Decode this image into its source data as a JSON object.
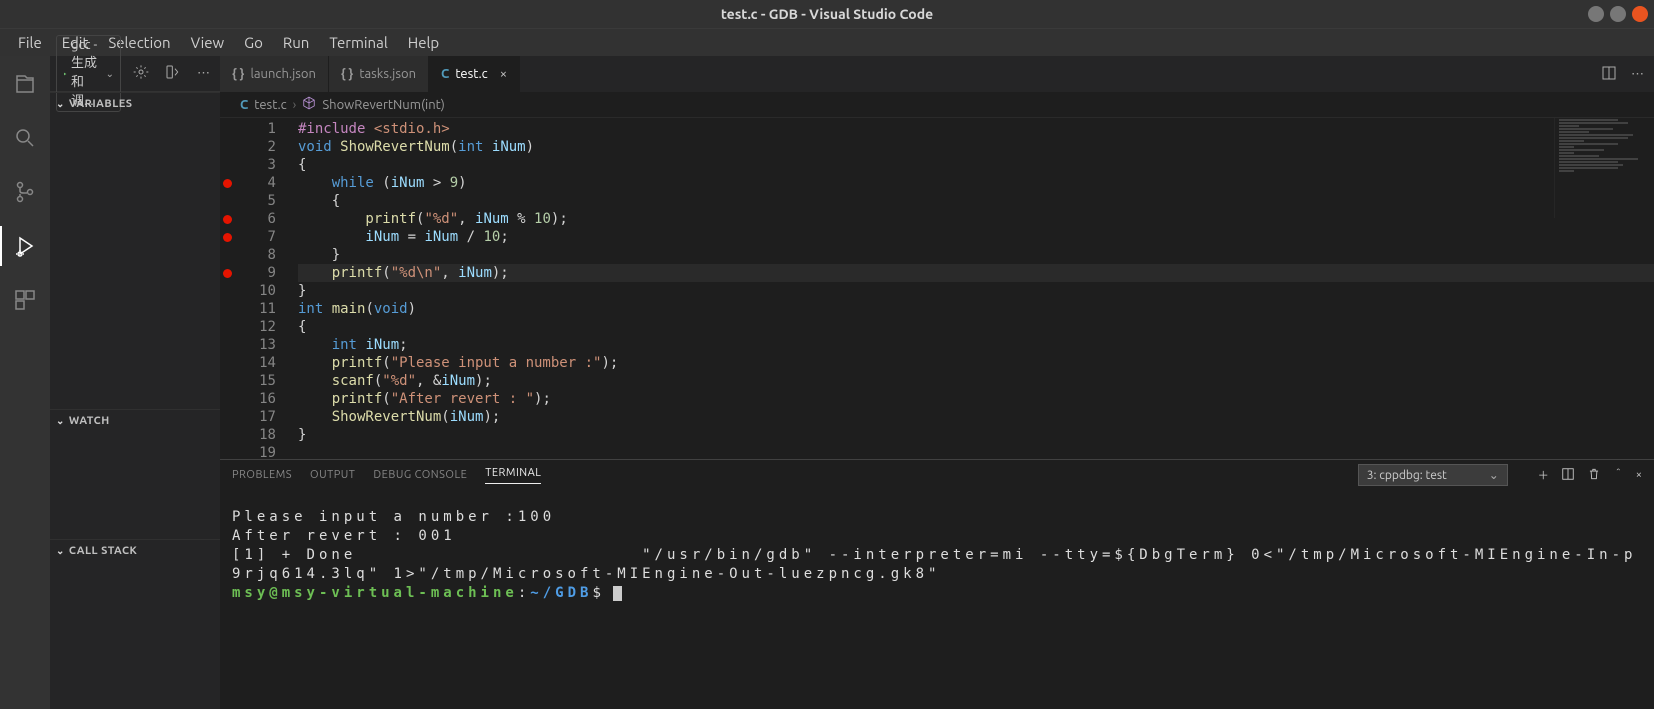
{
  "window": {
    "title": "test.c - GDB - Visual Studio Code"
  },
  "menu": {
    "file": "File",
    "edit": "Edit",
    "selection": "Selection",
    "view": "View",
    "go": "Go",
    "run": "Run",
    "terminal": "Terminal",
    "help": "Help"
  },
  "debugbar": {
    "config_label": "gcc - 生成和调..."
  },
  "sidebar": {
    "sec_variables": "VARIABLES",
    "sec_watch": "WATCH",
    "sec_callstack": "CALL STACK"
  },
  "tabs": {
    "launch": "launch.json",
    "tasks": "tasks.json",
    "test": "test.c"
  },
  "breadcrumb": {
    "file": "test.c",
    "symbol": "ShowRevertNum(int)"
  },
  "code_lines": [
    {
      "n": "1",
      "bp": false,
      "html": "<span class='tok-inc'>#include </span><span class='tok-inc2'>&lt;stdio.h&gt;</span>"
    },
    {
      "n": "2",
      "bp": false,
      "html": "<span class='tok-kw'>void</span> <span class='tok-fn'>ShowRevertNum</span>(<span class='tok-kw'>int</span> <span class='tok-var'>iNum</span>)"
    },
    {
      "n": "3",
      "bp": false,
      "html": "{"
    },
    {
      "n": "4",
      "bp": true,
      "html": "    <span class='tok-kw'>while</span> (<span class='tok-var'>iNum</span> &gt; <span class='tok-num'>9</span>)"
    },
    {
      "n": "5",
      "bp": false,
      "html": "    {"
    },
    {
      "n": "6",
      "bp": true,
      "html": "        <span class='tok-fn'>printf</span>(<span class='tok-str'>\"%d\"</span>, <span class='tok-var'>iNum</span> % <span class='tok-num'>10</span>);"
    },
    {
      "n": "7",
      "bp": true,
      "html": "        <span class='tok-var'>iNum</span> = <span class='tok-var'>iNum</span> / <span class='tok-num'>10</span>;"
    },
    {
      "n": "8",
      "bp": false,
      "html": "    }"
    },
    {
      "n": "9",
      "bp": true,
      "hl": true,
      "html": "    <span class='tok-fn'>printf</span>(<span class='tok-str'>\"%d\\n\"</span>, <span class='tok-var'>iNum</span>);"
    },
    {
      "n": "10",
      "bp": false,
      "html": "}"
    },
    {
      "n": "11",
      "bp": false,
      "html": "<span class='tok-kw'>int</span> <span class='tok-fn'>main</span>(<span class='tok-kw'>void</span>)"
    },
    {
      "n": "12",
      "bp": false,
      "html": "{"
    },
    {
      "n": "13",
      "bp": false,
      "html": "    <span class='tok-kw'>int</span> <span class='tok-var'>iNum</span>;"
    },
    {
      "n": "14",
      "bp": false,
      "html": "    <span class='tok-fn'>printf</span>(<span class='tok-str'>\"Please input a number :\"</span>);"
    },
    {
      "n": "15",
      "bp": false,
      "html": "    <span class='tok-fn'>scanf</span>(<span class='tok-str'>\"%d\"</span>, &amp;<span class='tok-var'>iNum</span>);"
    },
    {
      "n": "16",
      "bp": false,
      "html": "    <span class='tok-fn'>printf</span>(<span class='tok-str'>\"After revert : \"</span>);"
    },
    {
      "n": "17",
      "bp": false,
      "html": "    <span class='tok-fn'>ShowRevertNum</span>(<span class='tok-var'>iNum</span>);"
    },
    {
      "n": "18",
      "bp": false,
      "html": "}"
    },
    {
      "n": "19",
      "bp": false,
      "html": ""
    }
  ],
  "panel": {
    "tabs": {
      "problems": "PROBLEMS",
      "output": "OUTPUT",
      "debug": "DEBUG CONSOLE",
      "terminal": "TERMINAL"
    },
    "selector": "3: cppdbg: test",
    "lines": [
      "Please input a number :100",
      "After revert : 001",
      "[1] + Done                       \"/usr/bin/gdb\" --interpreter=mi --tty=${DbgTerm} 0<\"/tmp/Microsoft-MIEngine-In-p9rjq614.3lq\" 1>\"/tmp/Microsoft-MIEngine-Out-luezpncg.gk8\""
    ],
    "prompt_user": "msy@msy-virtual-machine",
    "prompt_colon": ":",
    "prompt_path": "~/GDB",
    "prompt_suffix": "$"
  }
}
